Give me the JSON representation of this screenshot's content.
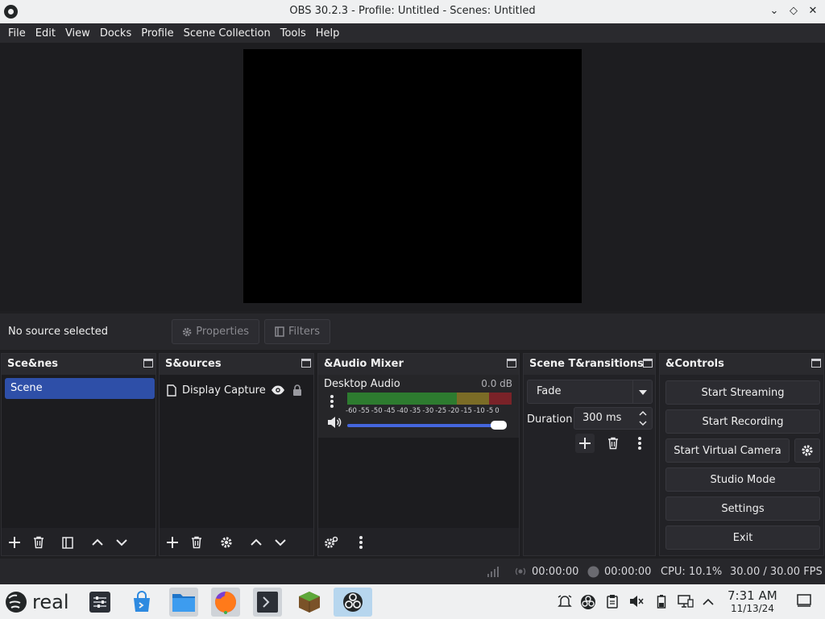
{
  "window": {
    "title": "OBS 30.2.3 - Profile: Untitled - Scenes: Untitled"
  },
  "menu": [
    "File",
    "Edit",
    "View",
    "Docks",
    "Profile",
    "Scene Collection",
    "Tools",
    "Help"
  ],
  "source_toolbar": {
    "status": "No source selected",
    "properties_label": "Properties",
    "filters_label": "Filters"
  },
  "scenes": {
    "title": "Sce&nes",
    "items": [
      "Scene"
    ]
  },
  "sources": {
    "title": "S&ources",
    "items": [
      {
        "label": "Display Capture (",
        "visible": true,
        "locked": true
      }
    ]
  },
  "audio_mixer": {
    "title": "&Audio Mixer",
    "channels": [
      {
        "name": "Desktop Audio",
        "level": "0.0 dB",
        "volume_fraction": 0.97
      }
    ],
    "ticks": [
      "-60",
      "-55",
      "-50",
      "-45",
      "-40",
      "-35",
      "-30",
      "-25",
      "-20",
      "-15",
      "-10",
      "-5",
      "0"
    ]
  },
  "transitions": {
    "title": "Scene T&ransitions",
    "selected": "Fade",
    "duration_label": "Duration",
    "duration_value": "300 ms"
  },
  "controls": {
    "title": "&Controls",
    "start_streaming": "Start Streaming",
    "start_recording": "Start Recording",
    "start_virtual_camera": "Start Virtual Camera",
    "studio_mode": "Studio Mode",
    "settings": "Settings",
    "exit": "Exit"
  },
  "status": {
    "stream_time": "00:00:00",
    "record_time": "00:00:00",
    "cpu": "CPU: 10.1%",
    "fps": "30.00 / 30.00 FPS"
  },
  "taskbar": {
    "launcher_label": "real",
    "clock_time": "7:31 AM",
    "clock_date": "11/13/24"
  },
  "colors": {
    "scene_selected": "#2e4fa8",
    "meter_green": "#2d7b2f",
    "meter_yellow": "#7b6c26",
    "meter_red": "#7a2228",
    "volume_track": "#4466dd"
  }
}
